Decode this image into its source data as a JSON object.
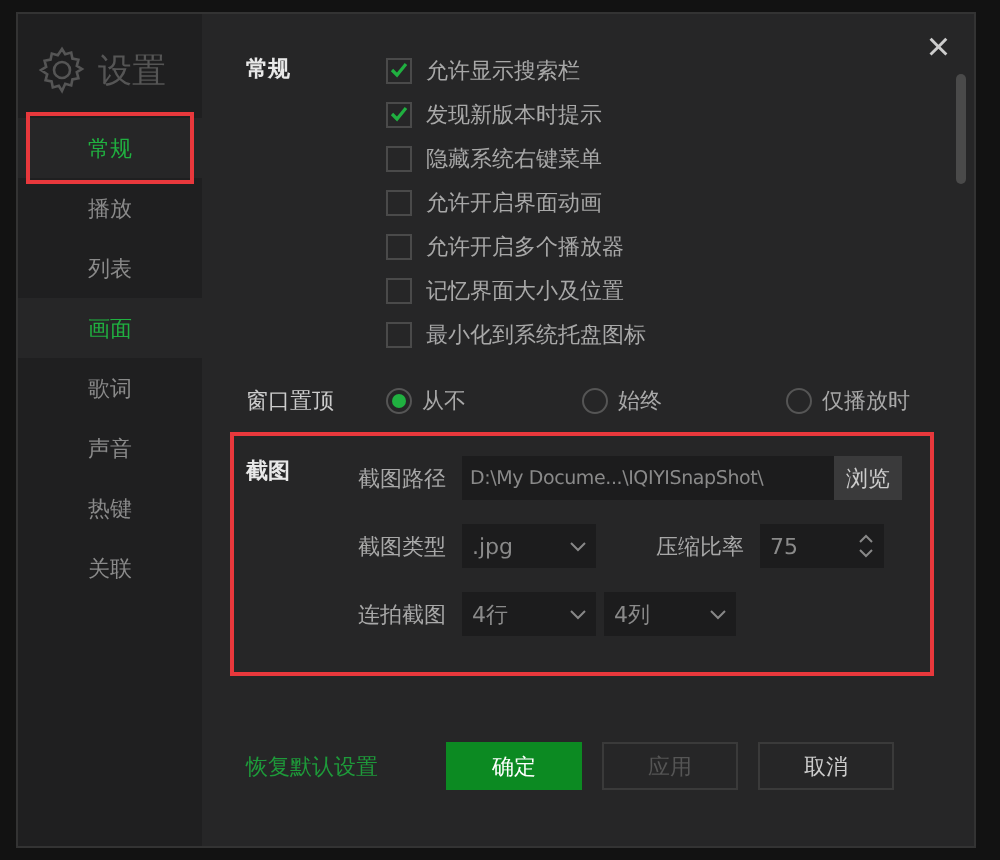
{
  "window": {
    "title": "设置",
    "close": "×"
  },
  "sidebar": {
    "items": [
      {
        "label": "常规",
        "selected": true,
        "highlighted": true
      },
      {
        "label": "播放",
        "selected": false,
        "highlighted": false
      },
      {
        "label": "列表",
        "selected": false,
        "highlighted": false
      },
      {
        "label": "画面",
        "selected": true,
        "highlighted": false
      },
      {
        "label": "歌词",
        "selected": false,
        "highlighted": false
      },
      {
        "label": "声音",
        "selected": false,
        "highlighted": false
      },
      {
        "label": "热键",
        "selected": false,
        "highlighted": false
      },
      {
        "label": "关联",
        "selected": false,
        "highlighted": false
      }
    ]
  },
  "general": {
    "label": "常规",
    "options": [
      {
        "label": "允许显示搜索栏",
        "checked": true
      },
      {
        "label": "发现新版本时提示",
        "checked": true
      },
      {
        "label": "隐藏系统右键菜单",
        "checked": false
      },
      {
        "label": "允许开启界面动画",
        "checked": false
      },
      {
        "label": "允许开启多个播放器",
        "checked": false
      },
      {
        "label": "记忆界面大小及位置",
        "checked": false
      },
      {
        "label": "最小化到系统托盘图标",
        "checked": false
      }
    ]
  },
  "window_on_top": {
    "label": "窗口置顶",
    "options": [
      {
        "label": "从不",
        "selected": true
      },
      {
        "label": "始终",
        "selected": false
      },
      {
        "label": "仅播放时",
        "selected": false
      }
    ]
  },
  "snapshot": {
    "label": "截图",
    "highlighted": true,
    "path": {
      "label": "截图路径",
      "value": "D:\\My Docume...\\IQIYISnapShot\\",
      "button": "浏览"
    },
    "type": {
      "label": "截图类型",
      "value": ".jpg"
    },
    "compression": {
      "label": "压缩比率",
      "value": "75"
    },
    "burst": {
      "label": "连拍截图",
      "rows": "4行",
      "columns": "4列"
    }
  },
  "footer": {
    "reset": "恢复默认设置",
    "buttons": [
      {
        "label": "确定",
        "kind": "primary"
      },
      {
        "label": "应用",
        "kind": "disabled"
      },
      {
        "label": "取消",
        "kind": "normal"
      }
    ]
  }
}
